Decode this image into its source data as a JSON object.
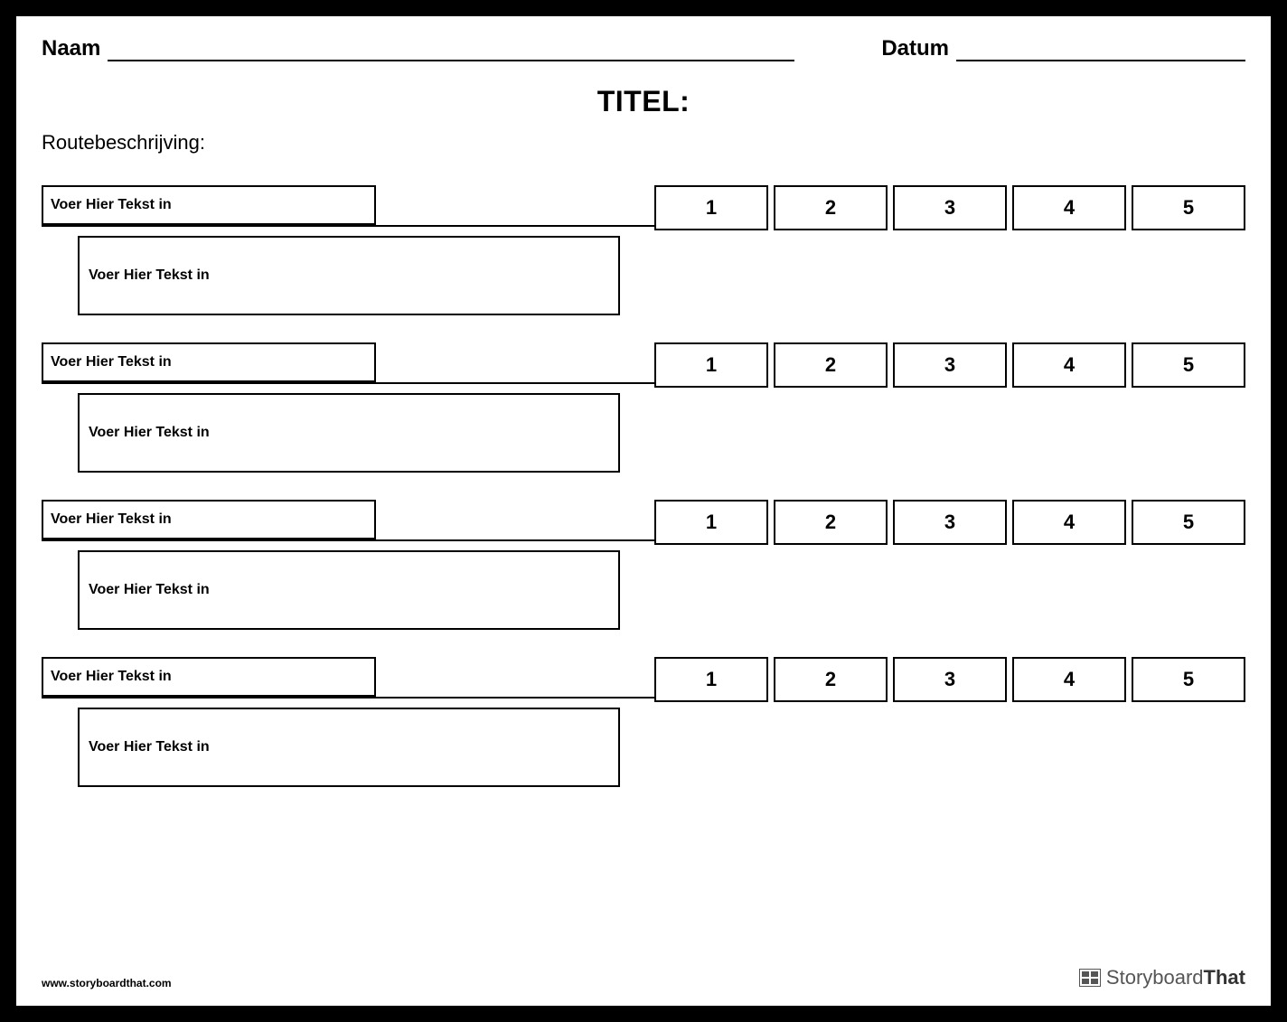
{
  "header": {
    "name_label": "Naam",
    "date_label": "Datum"
  },
  "title": "TITEL:",
  "directions_label": "Routebeschrijving:",
  "rows": [
    {
      "small_placeholder": "Voer Hier Tekst in",
      "large_placeholder": "Voer Hier Tekst in",
      "ratings": [
        "1",
        "2",
        "3",
        "4",
        "5"
      ]
    },
    {
      "small_placeholder": "Voer Hier Tekst in",
      "large_placeholder": "Voer Hier Tekst in",
      "ratings": [
        "1",
        "2",
        "3",
        "4",
        "5"
      ]
    },
    {
      "small_placeholder": "Voer Hier Tekst in",
      "large_placeholder": "Voer Hier Tekst in",
      "ratings": [
        "1",
        "2",
        "3",
        "4",
        "5"
      ]
    },
    {
      "small_placeholder": "Voer Hier Tekst in",
      "large_placeholder": "Voer Hier Tekst in",
      "ratings": [
        "1",
        "2",
        "3",
        "4",
        "5"
      ]
    }
  ],
  "footer": {
    "url": "www.storyboardthat.com",
    "brand_prefix": "Storyboard",
    "brand_suffix": "That"
  }
}
